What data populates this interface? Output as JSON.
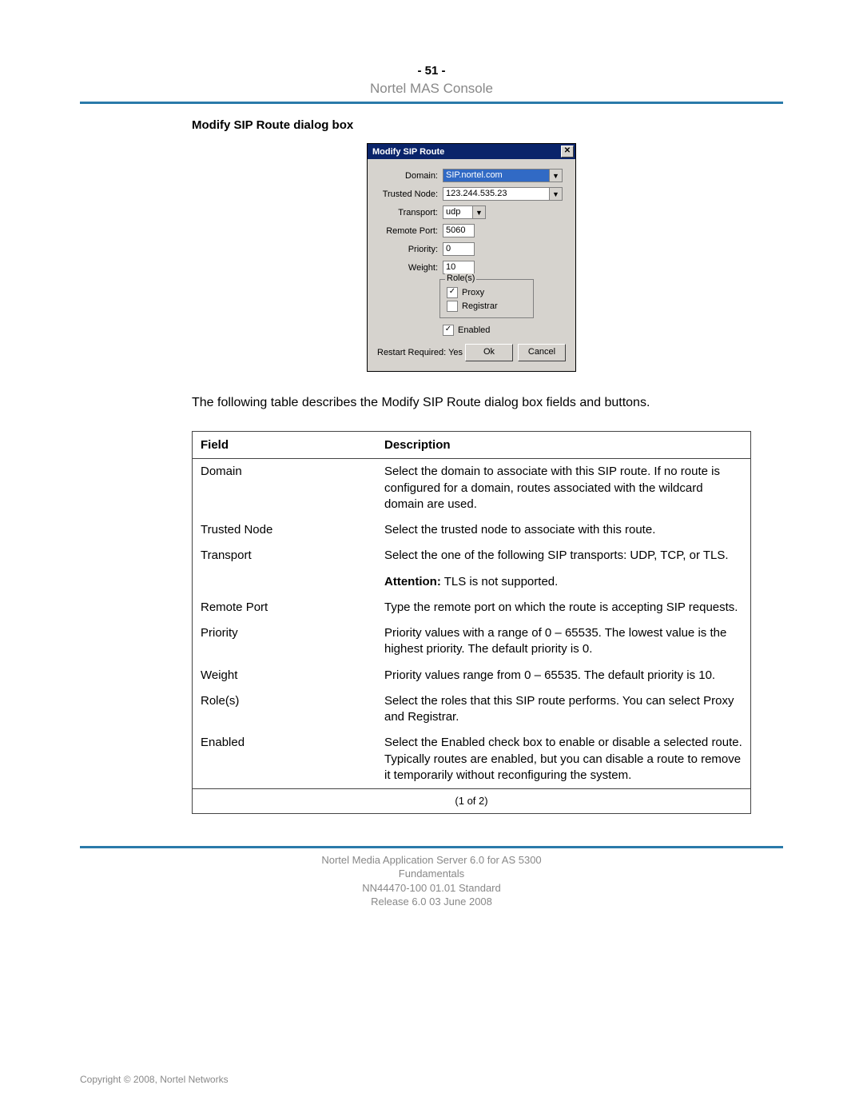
{
  "page_number": "- 51 -",
  "header_title": "Nortel MAS Console",
  "section_heading": "Modify SIP Route dialog box",
  "dialog": {
    "title": "Modify SIP Route",
    "close_glyph": "✕",
    "fields": {
      "domain_label": "Domain:",
      "domain_value": "SIP.nortel.com",
      "trusted_label": "Trusted Node:",
      "trusted_value": "123.244.535.23",
      "transport_label": "Transport:",
      "transport_value": "udp",
      "remote_port_label": "Remote Port:",
      "remote_port_value": "5060",
      "priority_label": "Priority:",
      "priority_value": "0",
      "weight_label": "Weight:",
      "weight_value": "10"
    },
    "roles": {
      "legend": "Role(s)",
      "proxy_label": "Proxy",
      "proxy_checked": "✓",
      "registrar_label": "Registrar",
      "registrar_checked": ""
    },
    "enabled_label": "Enabled",
    "enabled_checked": "✓",
    "restart_text": "Restart Required: Yes",
    "ok_label": "Ok",
    "cancel_label": "Cancel",
    "dropdown_glyph": "▼"
  },
  "intro_para": "The following table describes the Modify SIP Route dialog box fields and buttons.",
  "table": {
    "head_field": "Field",
    "head_desc": "Description",
    "rows": [
      {
        "field": "Domain",
        "desc": "Select the domain to associate with this SIP route. If no route is configured for a domain, routes associated with the wildcard domain are used."
      },
      {
        "field": "Trusted Node",
        "desc": "Select the trusted node to associate with this route."
      },
      {
        "field": "Transport",
        "desc": "Select the one of the following SIP transports: UDP, TCP, or TLS."
      },
      {
        "field": "",
        "desc_prefix_bold": "Attention:",
        "desc": "  TLS is not supported."
      },
      {
        "field": "Remote Port",
        "desc": "Type the remote port on which the route is accepting SIP requests."
      },
      {
        "field": "Priority",
        "desc": "Priority values with a range of 0 – 65535. The lowest value is the highest priority. The default priority is 0."
      },
      {
        "field": "Weight",
        "desc": "Priority values range from 0 – 65535. The default priority is 10."
      },
      {
        "field": "Role(s)",
        "desc": "Select the roles that this SIP route performs. You can select Proxy and Registrar."
      },
      {
        "field": "Enabled",
        "desc": "Select the Enabled check box to enable or disable a selected route. Typically routes are enabled, but you can disable a route to remove it temporarily without reconfiguring the system."
      }
    ],
    "footer": "(1 of 2)"
  },
  "footer": {
    "line1": "Nortel Media Application Server 6.0 for AS 5300",
    "line2": "Fundamentals",
    "line3": "NN44470-100   01.01   Standard",
    "line4": "Release 6.0   03 June 2008"
  },
  "copyright": "Copyright © 2008, Nortel Networks"
}
